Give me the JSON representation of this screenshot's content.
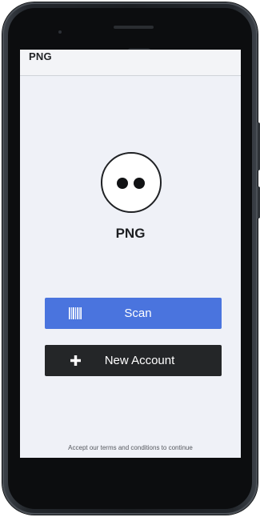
{
  "app": {
    "header_title": "PNG",
    "name": "PNG"
  },
  "actions": {
    "scan_label": "Scan",
    "scan_icon": "barcode-icon",
    "new_account_label": "New Account",
    "new_account_icon": "plus-icon"
  },
  "footer": {
    "terms_text": "Accept our terms and conditions to continue"
  },
  "colors": {
    "scan_button": "#4a74de",
    "new_account_button": "#242628",
    "screen_background": "#eff1f7",
    "button_text": "#ffffff"
  }
}
